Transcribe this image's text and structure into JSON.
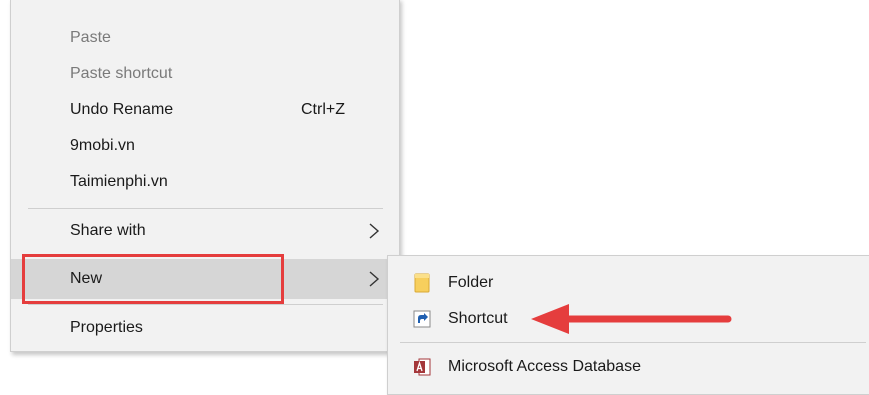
{
  "context_menu": {
    "items": [
      {
        "label": "Paste",
        "enabled": false
      },
      {
        "label": "Paste shortcut",
        "enabled": false
      },
      {
        "label": "Undo Rename",
        "accelerator": "Ctrl+Z",
        "enabled": true
      },
      {
        "label": "9mobi.vn",
        "enabled": true
      },
      {
        "label": "Taimienphi.vn",
        "enabled": true
      },
      {
        "label": "Share with",
        "has_submenu": true,
        "enabled": true
      },
      {
        "label": "New",
        "has_submenu": true,
        "enabled": true,
        "highlighted": true
      },
      {
        "label": "Properties",
        "enabled": true
      }
    ]
  },
  "submenu_new": {
    "items": [
      {
        "label": "Folder",
        "icon": "folder-icon"
      },
      {
        "label": "Shortcut",
        "icon": "shortcut-icon"
      },
      {
        "label": "Microsoft Access Database",
        "icon": "access-icon"
      }
    ]
  },
  "annotation": {
    "color": "#e53d3d",
    "box_target": "New",
    "arrow_target": "Shortcut"
  },
  "colors": {
    "menu_bg": "#f2f2f2",
    "hover_bg": "#d6d6d6",
    "disabled_text": "#7a7a7a",
    "accent_red": "#e53d3d"
  }
}
